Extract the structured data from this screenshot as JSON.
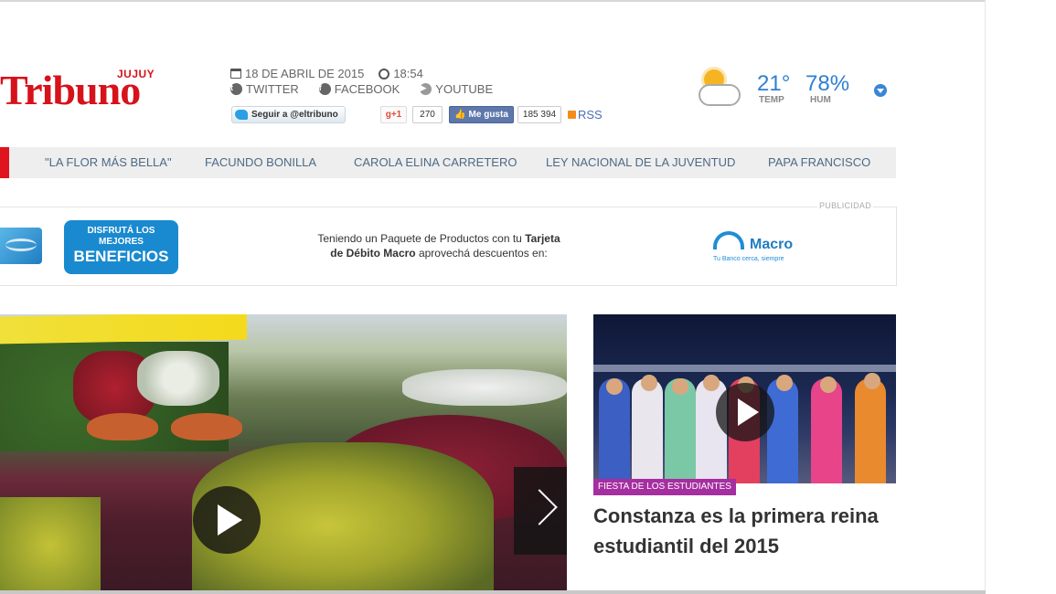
{
  "logo": {
    "region": "JUJUY",
    "name": "Tribuno"
  },
  "meta": {
    "date": "18 DE ABRIL DE 2015",
    "time": "18:54",
    "twitter": "TWITTER",
    "facebook": "FACEBOOK",
    "youtube": "YOUTUBE"
  },
  "social": {
    "twitter_follow": "Seguir a @eltribuno",
    "gplus_label": "g+1",
    "gplus_count": "270",
    "fb_like": "Me gusta",
    "fb_count": "185 394",
    "rss": "RSS"
  },
  "weather": {
    "temp": "21°",
    "temp_label": "TEMP",
    "hum": "78%",
    "hum_label": "HUM",
    "icon": "partly-cloudy-icon"
  },
  "nav": {
    "items": [
      "\"LA FLOR MÁS BELLA\"",
      "FACUNDO BONILLA",
      "CAROLA ELINA CARRETERO",
      "LEY NACIONAL DE LA JUVENTUD",
      "PAPA FRANCISCO"
    ],
    "accent": "#e0141e"
  },
  "ad": {
    "label": "PUBLICIDAD",
    "pill_line1": "DISFRUTÁ LOS",
    "pill_line2": "MEJORES",
    "pill_line3": "BENEFICIOS",
    "text_a": "Teniendo un Paquete de Productos con tu ",
    "text_b": "Tarjeta",
    "text_c": "de Débito Macro",
    "text_d": " aprovechá descuentos en:",
    "brand": "Macro",
    "brand_tag": "Tu Banco cerca, siempre"
  },
  "feature": {
    "tag": "FIESTA DE LOS ESTUDIANTES",
    "headline": "Constanza es la primera reina estudiantil del 2015",
    "tag_color": "#a52fa0"
  }
}
